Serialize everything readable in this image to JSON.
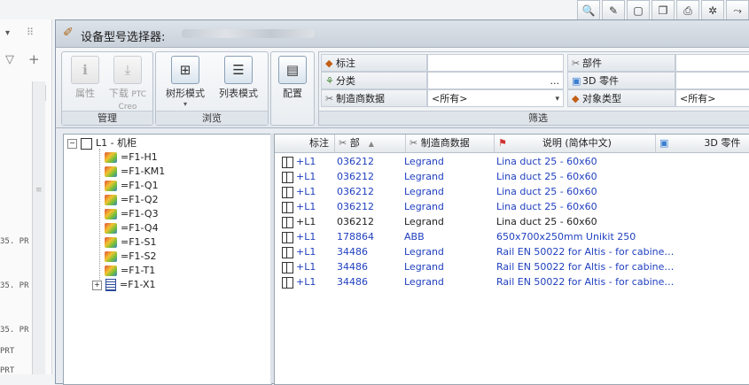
{
  "left_panel": {
    "labels": [
      "35. PR",
      "35. PR",
      "35. PR",
      "PRT",
      "PRT"
    ]
  },
  "dialog": {
    "title": "设备型号选择器:"
  },
  "ribbon": {
    "manage": {
      "caption": "管理",
      "properties_label": "属性",
      "download_label": "下载",
      "ptc_label": "PTC",
      "creo_label": "Creo"
    },
    "browse": {
      "caption": "浏览",
      "tree_mode_label": "树形模式",
      "list_mode_label": "列表模式"
    },
    "config": {
      "label": "配置"
    },
    "filter": {
      "caption": "筛选",
      "tag_label": "标注",
      "category_label": "分类",
      "manufacturer_label": "制造商数据",
      "manufacturer_value": "<所有>",
      "part_label": "部件",
      "part3d_label": "3D 零件",
      "objtype_label": "对象类型",
      "objtype_value": "<所有>",
      "ellipsis": "..."
    }
  },
  "tree": {
    "root": "L1 - 机柜",
    "items": [
      "=F1-H1",
      "=F1-KM1",
      "=F1-Q1",
      "=F1-Q2",
      "=F1-Q3",
      "=F1-Q4",
      "=F1-S1",
      "=F1-S2",
      "=F1-T1",
      "=F1-X1"
    ]
  },
  "list": {
    "headers": {
      "tag": "标注",
      "part": "部",
      "manufacturer": "制造商数据",
      "description": "说明 (简体中文)",
      "part3d": "3D 零件"
    },
    "rows": [
      {
        "tag": "+L1",
        "part": "036212",
        "manufacturer": "Legrand",
        "description": "Lina duct 25 - 60x60"
      },
      {
        "tag": "+L1",
        "part": "036212",
        "manufacturer": "Legrand",
        "description": "Lina duct 25 - 60x60"
      },
      {
        "tag": "+L1",
        "part": "036212",
        "manufacturer": "Legrand",
        "description": "Lina duct 25 - 60x60"
      },
      {
        "tag": "+L1",
        "part": "036212",
        "manufacturer": "Legrand",
        "description": "Lina duct 25 - 60x60"
      },
      {
        "tag": "+L1",
        "part": "036212",
        "manufacturer": "Legrand",
        "description": "Lina duct 25 - 60x60"
      },
      {
        "tag": "+L1",
        "part": "178864",
        "manufacturer": "ABB",
        "description": "650x700x250mm Unikit 250"
      },
      {
        "tag": "+L1",
        "part": "34486",
        "manufacturer": "Legrand",
        "description": "Rail EN 50022 for Altis - for cabine…"
      },
      {
        "tag": "+L1",
        "part": "34486",
        "manufacturer": "Legrand",
        "description": "Rail EN 50022 for Altis - for cabine…"
      },
      {
        "tag": "+L1",
        "part": "34486",
        "manufacturer": "Legrand",
        "description": "Rail EN 50022 for Altis - for cabine…"
      }
    ]
  },
  "colors": {
    "link_blue": "#1f3fbf",
    "accent_orange": "#c25f16"
  }
}
